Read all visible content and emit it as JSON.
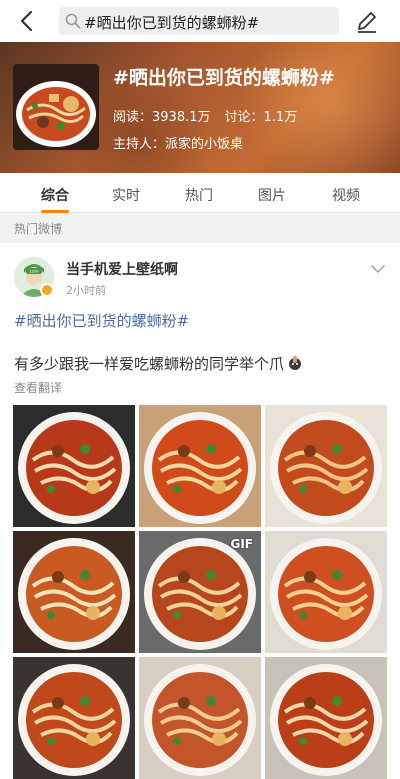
{
  "search": {
    "query": "#晒出你已到货的螺蛳粉#"
  },
  "topic": {
    "title": "#晒出你已到货的螺蛳粉#",
    "reads_label": "阅读：",
    "reads_value": "3938.1万",
    "discuss_label": "讨论：",
    "discuss_value": "1.1万",
    "host_label": "主持人：",
    "host_name": "派家的小饭桌"
  },
  "tabs": [
    {
      "label": "综合",
      "active": true
    },
    {
      "label": "实时",
      "active": false
    },
    {
      "label": "热门",
      "active": false
    },
    {
      "label": "图片",
      "active": false
    },
    {
      "label": "视频",
      "active": false
    }
  ],
  "section_label": "热门微博",
  "post": {
    "author": "当手机爱上壁纸啊",
    "time": "2小时前",
    "topic_tag": "#晒出你已到货的螺蛳粉#",
    "text": "有多少跟我一样爱吃螺蛳粉的同学举个爪",
    "translate": "查看翻译",
    "images": [
      {
        "gif": false,
        "badge": ""
      },
      {
        "gif": false,
        "badge": ""
      },
      {
        "gif": false,
        "badge": ""
      },
      {
        "gif": false,
        "badge": ""
      },
      {
        "gif": true,
        "badge": "GIF"
      },
      {
        "gif": false,
        "badge": ""
      },
      {
        "gif": false,
        "badge": ""
      },
      {
        "gif": false,
        "badge": ""
      },
      {
        "gif": false,
        "badge": ""
      }
    ]
  },
  "colors": {
    "accent": "#ff8200",
    "link": "#4a6fa5"
  }
}
